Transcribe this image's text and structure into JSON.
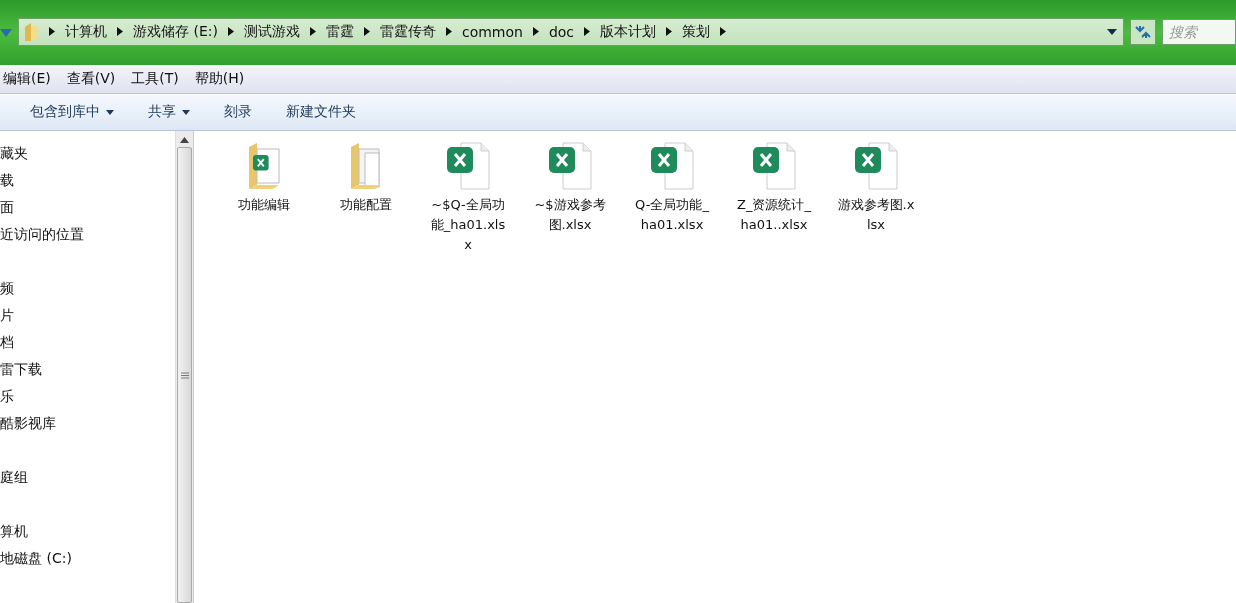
{
  "address_bar": {
    "path": [
      "计算机",
      "游戏储存 (E:)",
      "测试游戏",
      "雷霆",
      "雷霆传奇",
      "common",
      "doc",
      "版本计划",
      "策划"
    ]
  },
  "search": {
    "placeholder": "搜索"
  },
  "menu": [
    "编辑(E)",
    "查看(V)",
    "工具(T)",
    "帮助(H)"
  ],
  "toolbar": [
    {
      "label": "包含到库中",
      "dropdown": true
    },
    {
      "label": "共享",
      "dropdown": true
    },
    {
      "label": "刻录",
      "dropdown": false
    },
    {
      "label": "新建文件夹",
      "dropdown": false
    }
  ],
  "sidebar": {
    "groups": [
      [
        "藏夹",
        "载",
        "面",
        "近访问的位置"
      ],
      [
        "频",
        "片",
        "档",
        "雷下载",
        "乐",
        "酷影视库"
      ],
      [
        "庭组"
      ],
      [
        "算机",
        "地磁盘 (C:)"
      ]
    ]
  },
  "files": [
    {
      "name": "功能编辑",
      "kind": "folder-excel"
    },
    {
      "name": "功能配置",
      "kind": "folder"
    },
    {
      "name": "~$Q-全局功能_ha01.xlsx",
      "kind": "excel"
    },
    {
      "name": "~$游戏参考图.xlsx",
      "kind": "excel"
    },
    {
      "name": "Q-全局功能_ha01.xlsx",
      "kind": "excel"
    },
    {
      "name": "Z_资源统计_ha01..xlsx",
      "kind": "excel"
    },
    {
      "name": "游戏参考图.xlsx",
      "kind": "excel"
    }
  ]
}
